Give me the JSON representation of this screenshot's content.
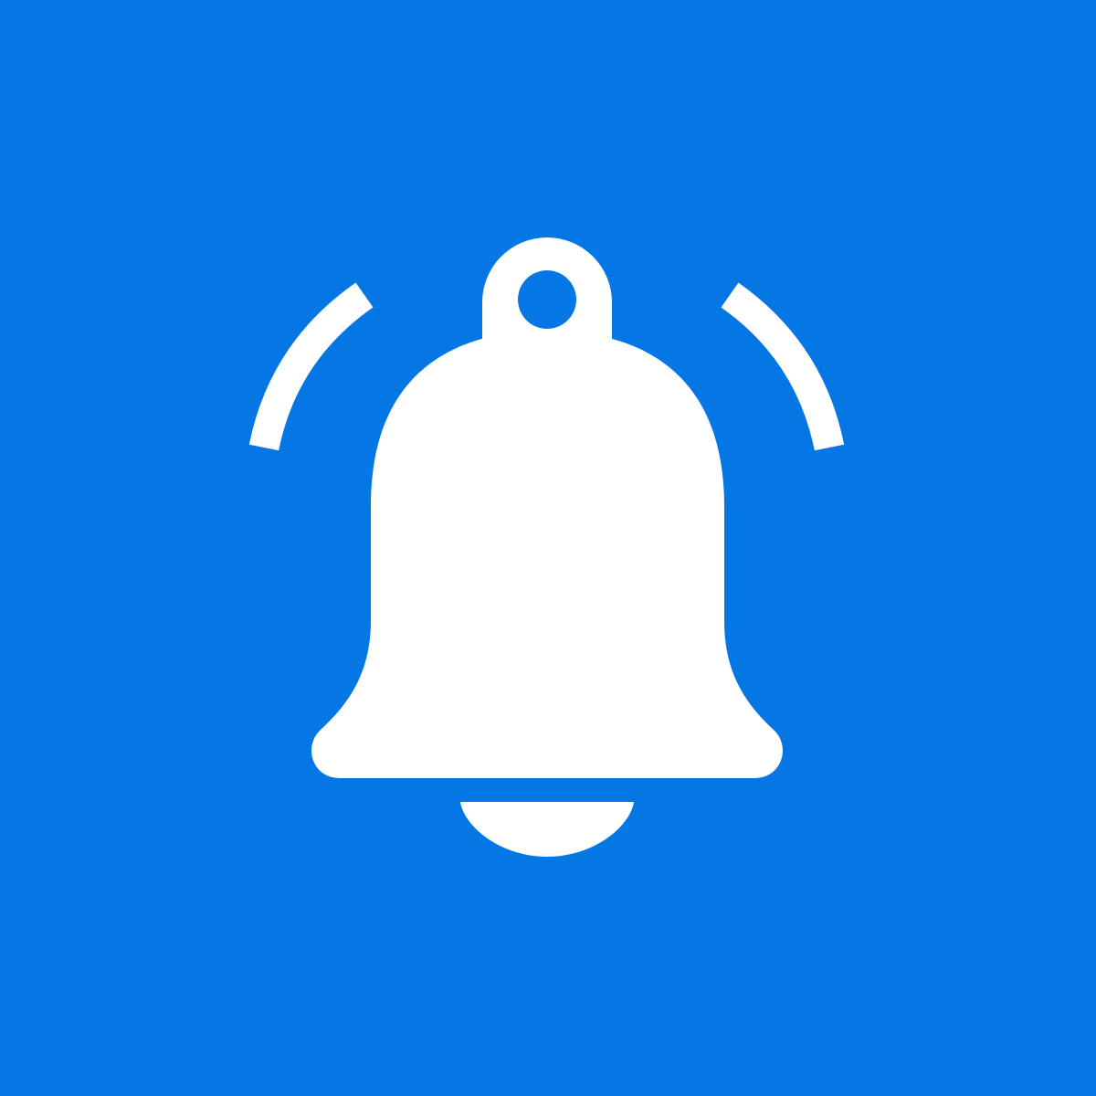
{
  "colors": {
    "background": "#0477E4",
    "foreground": "#FFFFFF"
  },
  "icon": {
    "name": "notification-bell-icon",
    "state": "ringing"
  }
}
